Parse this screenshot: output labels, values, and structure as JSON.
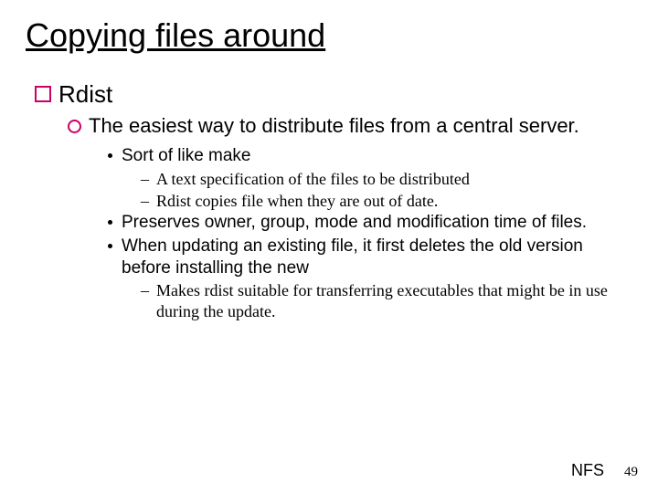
{
  "title": "Copying files around",
  "lvl1_1": "Rdist",
  "lvl2_1": "The easiest way to distribute files from a central server.",
  "lvl3_1": "Sort of like make",
  "lvl4_1": "A text specification of the files to be distributed",
  "lvl4_2": "Rdist copies file when they are out of date.",
  "lvl3_2": "Preserves owner, group, mode and modification time of files.",
  "lvl3_3": "When updating an existing file, it first deletes the old version before installing the new",
  "lvl4_3": "Makes rdist suitable for transferring executables that might be in use during the update.",
  "footer_label": "NFS",
  "footer_num": "49"
}
